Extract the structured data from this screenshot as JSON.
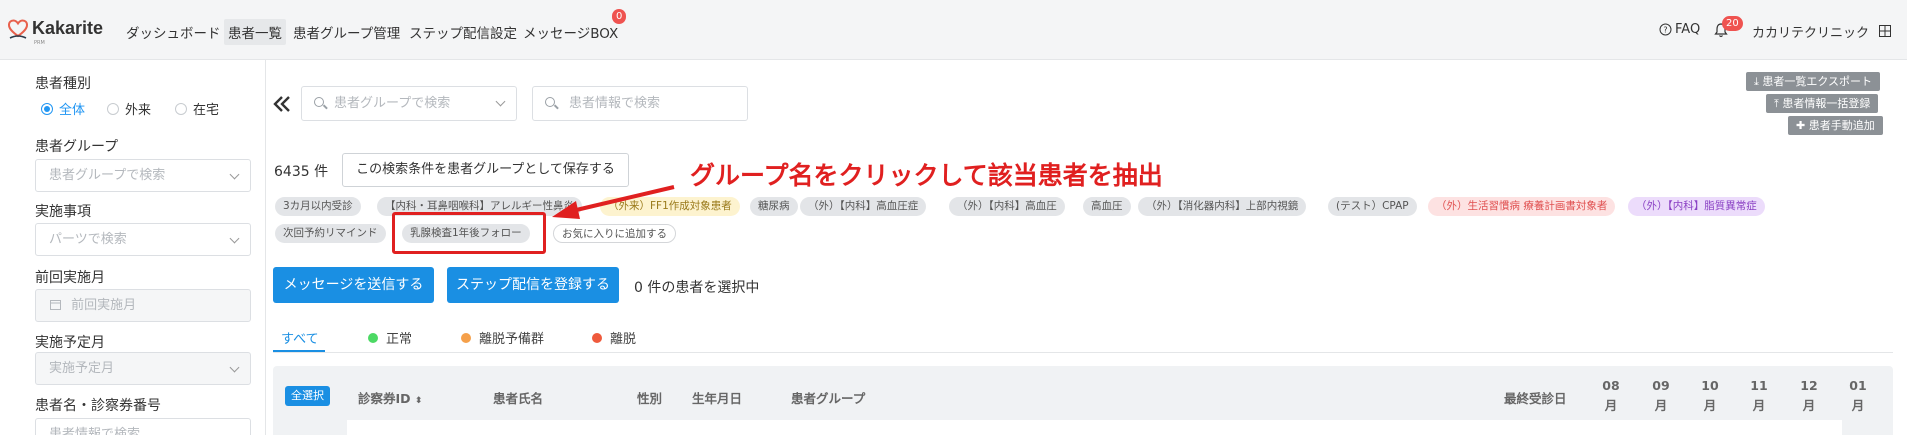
{
  "brand": {
    "name": "Kakarite",
    "sub": "PRM",
    "accent": "#e8604c"
  },
  "nav": {
    "items": [
      "ダッシュボード",
      "患者一覧",
      "患者グループ管理",
      "ステップ配信設定",
      "メッセージBOX"
    ],
    "message_badge": "0",
    "faq": "FAQ",
    "notification_badge": "20",
    "clinic": "カカリテクリニック"
  },
  "filters": {
    "patient_type_label": "患者種別",
    "patient_types": [
      "全体",
      "外来",
      "在宅"
    ],
    "group_label": "患者グループ",
    "group_placeholder": "患者グループで検索",
    "items_label": "実施事項",
    "items_placeholder": "パーツで検索",
    "prev_month_label": "前回実施月",
    "prev_month_placeholder": "前回実施月",
    "plan_month_label": "実施予定月",
    "plan_month_placeholder": "実施予定月",
    "name_label": "患者名・診察券番号",
    "name_placeholder": "患者情報で検索"
  },
  "toolbar": {
    "group_search_placeholder": "患者グループで検索",
    "info_search_placeholder": "患者情報で検索",
    "export": "患者一覧エクスポート",
    "bulk_register": "患者情報一括登録",
    "manual_add": "患者手動追加"
  },
  "results": {
    "count": "6435 件",
    "save_group": "この検索条件を患者グループとして保存する"
  },
  "tags_row1": [
    {
      "label": "3カ月以内受診",
      "style": "gray"
    },
    {
      "label": "【内科・耳鼻咽喉科】アレルギー性鼻炎",
      "style": "gray"
    },
    {
      "label": "（外来）FF1作成対象患者",
      "style": "yel"
    },
    {
      "label": "糖尿病",
      "style": "gray"
    },
    {
      "label": "（外）【内科】高血圧症",
      "style": "gray"
    },
    {
      "label": "（外）【内科】高血圧",
      "style": "gray"
    },
    {
      "label": "高血圧",
      "style": "gray"
    },
    {
      "label": "（外）【消化器内科】上部内視鏡",
      "style": "gray"
    },
    {
      "label": "(テスト）CPAP",
      "style": "gray"
    },
    {
      "label": "（外）生活習慣病 療養計画書対象者",
      "style": "red"
    },
    {
      "label": "（外）【内科】脂質異常症",
      "style": "pur"
    }
  ],
  "tags_row2": [
    {
      "label": "次回予約リマインド",
      "style": "gray"
    },
    {
      "label": "乳腺検査1年後フォロー",
      "style": "gray"
    },
    {
      "label": "お気に入りに追加する",
      "style": "out"
    }
  ],
  "annotation": {
    "text": "グループ名をクリックして該当患者を抽出",
    "color": "#e02020"
  },
  "actions": {
    "send_message": "メッセージを送信する",
    "register_step": "ステップ配信を登録する",
    "selected": "0 件の患者を選択中"
  },
  "tabs": [
    {
      "label": "すべて",
      "dot": ""
    },
    {
      "label": "正常",
      "dot": "#4cd964"
    },
    {
      "label": "離脱予備群",
      "dot": "#f5a04a"
    },
    {
      "label": "離脱",
      "dot": "#ef5a3c"
    }
  ],
  "table": {
    "select_all": "全選択",
    "headers": [
      "診察券ID",
      "患者氏名",
      "性別",
      "生年月日",
      "患者グループ",
      "最終受診日"
    ],
    "months": [
      {
        "num": "08",
        "unit": "月"
      },
      {
        "num": "09",
        "unit": "月"
      },
      {
        "num": "10",
        "unit": "月"
      },
      {
        "num": "11",
        "unit": "月"
      },
      {
        "num": "12",
        "unit": "月"
      },
      {
        "num": "01",
        "unit": "月"
      }
    ]
  }
}
